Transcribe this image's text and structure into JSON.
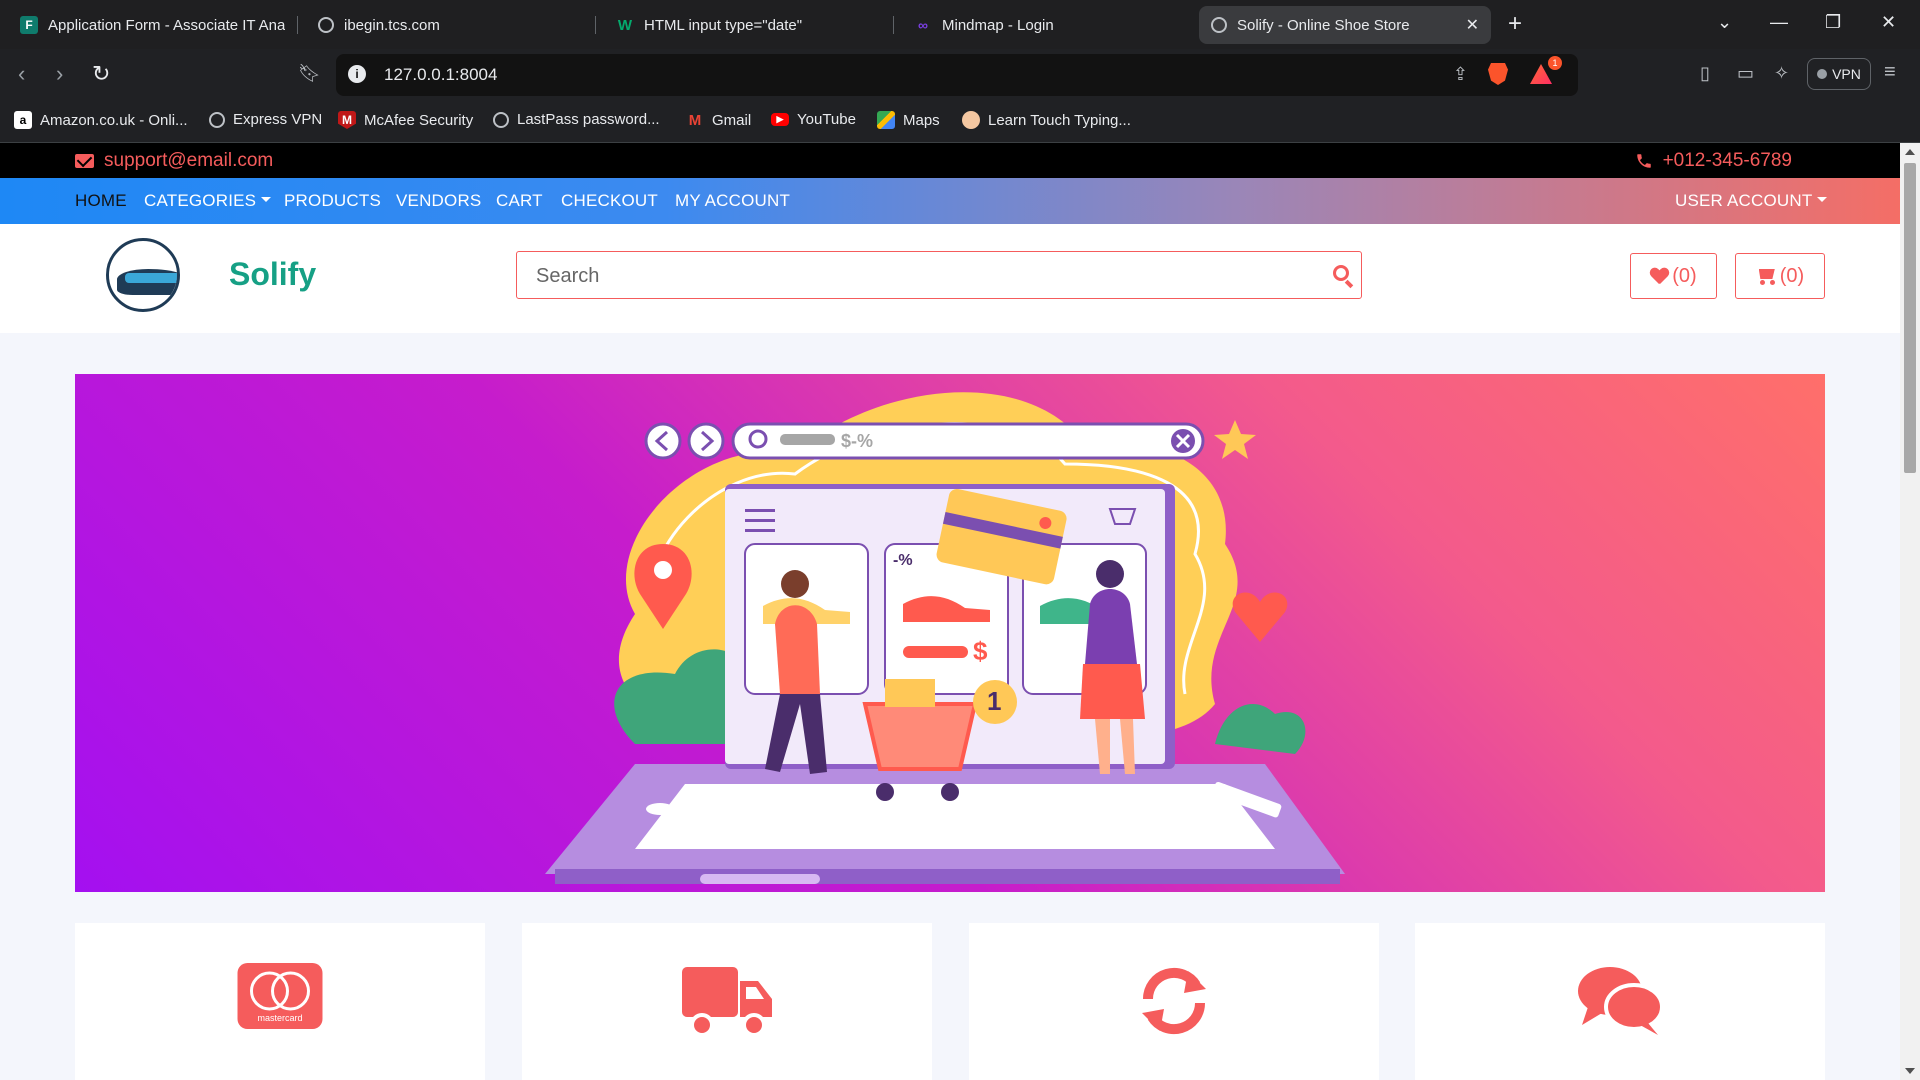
{
  "browser": {
    "tabs": [
      {
        "title": "Application Form - Associate IT Ana",
        "icon": "forms-icon",
        "active": false
      },
      {
        "title": "ibegin.tcs.com",
        "icon": "globe-icon",
        "active": false
      },
      {
        "title": "HTML input type=\"date\"",
        "icon": "w3schools-icon",
        "active": false
      },
      {
        "title": "Mindmap - Login",
        "icon": "mindmap-icon",
        "active": false
      },
      {
        "title": "Solify - Online Shoe Store",
        "icon": "globe-icon",
        "active": true
      }
    ],
    "url": "127.0.0.1:8004",
    "rewards_badge": "1",
    "vpn_label": "VPN",
    "bookmarks": [
      {
        "label": "Amazon.co.uk - Onli...",
        "icon": "amazon-icon"
      },
      {
        "label": "Express VPN",
        "icon": "globe-icon"
      },
      {
        "label": "McAfee Security",
        "icon": "mcafee-icon"
      },
      {
        "label": "LastPass password...",
        "icon": "globe-icon"
      },
      {
        "label": "Gmail",
        "icon": "gmail-icon"
      },
      {
        "label": "YouTube",
        "icon": "youtube-icon"
      },
      {
        "label": "Maps",
        "icon": "maps-icon"
      },
      {
        "label": "Learn Touch Typing...",
        "icon": "typing-icon"
      }
    ]
  },
  "site": {
    "email": "support@email.com",
    "phone": "+012-345-6789",
    "nav": {
      "items": [
        "HOME",
        "CATEGORIES",
        "PRODUCTS",
        "VENDORS",
        "CART",
        "CHECKOUT",
        "MY ACCOUNT"
      ],
      "user_account": "USER ACCOUNT"
    },
    "brand": "Solify",
    "search_placeholder": "Search",
    "wishlist_count": "(0)",
    "cart_count": "(0)",
    "hero": {
      "search_hint": "$-%",
      "price_tag": "$",
      "discount_tag": "-%",
      "cart_badge": "1"
    },
    "features": [
      {
        "icon": "mastercard-icon",
        "card_text": "mastercard"
      },
      {
        "icon": "truck-icon"
      },
      {
        "icon": "refresh-icon"
      },
      {
        "icon": "chat-icon"
      }
    ]
  },
  "colors": {
    "accent": "#f55c5c",
    "brand_green": "#16a085",
    "nav_gradient_start": "#1e88f5",
    "nav_gradient_end": "#f46e66",
    "hero_start": "#a410f0",
    "hero_end": "#ff6f6a"
  }
}
